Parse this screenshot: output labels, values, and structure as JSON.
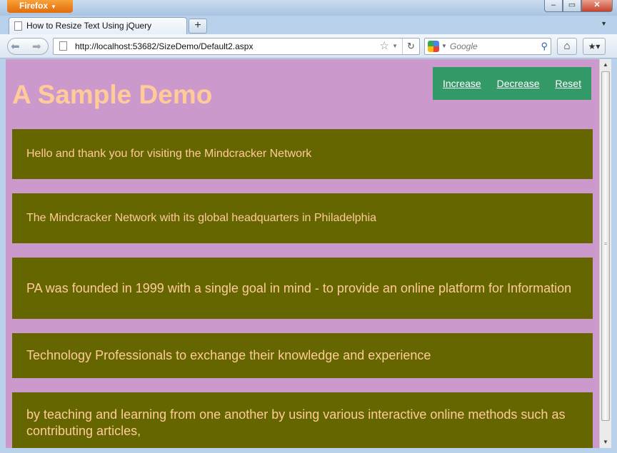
{
  "browser": {
    "menu_label": "Firefox",
    "tab_title": "How to Resize Text Using jQuery",
    "newtab_label": "+",
    "url": "http://localhost:53682/SizeDemo/Default2.aspx",
    "search_placeholder": "Google"
  },
  "page": {
    "title": "A Sample Demo",
    "links": [
      "Increase",
      "Decrease",
      "Reset"
    ],
    "paragraphs": [
      "Hello and thank you for visiting the Mindcracker Network",
      "The Mindcracker Network with its global headquarters in Philadelphia",
      "PA was founded in 1999 with a single goal in mind - to provide an online platform for Information",
      "Technology Professionals to exchange their knowledge and experience",
      "by teaching and learning from one another by using various interactive online methods such as contributing articles,"
    ]
  },
  "colors": {
    "page_background": "#cc99cc",
    "title_color": "#ffcc99",
    "link_panel": "#339966",
    "box_background": "#666600",
    "box_text": "#ffcc99"
  },
  "icons": [
    "page-icon",
    "back-arrow-icon",
    "forward-arrow-icon",
    "bookmark-star-icon",
    "reload-icon",
    "google-icon",
    "search-magnifier-icon",
    "home-icon",
    "bookmarks-menu-icon"
  ]
}
